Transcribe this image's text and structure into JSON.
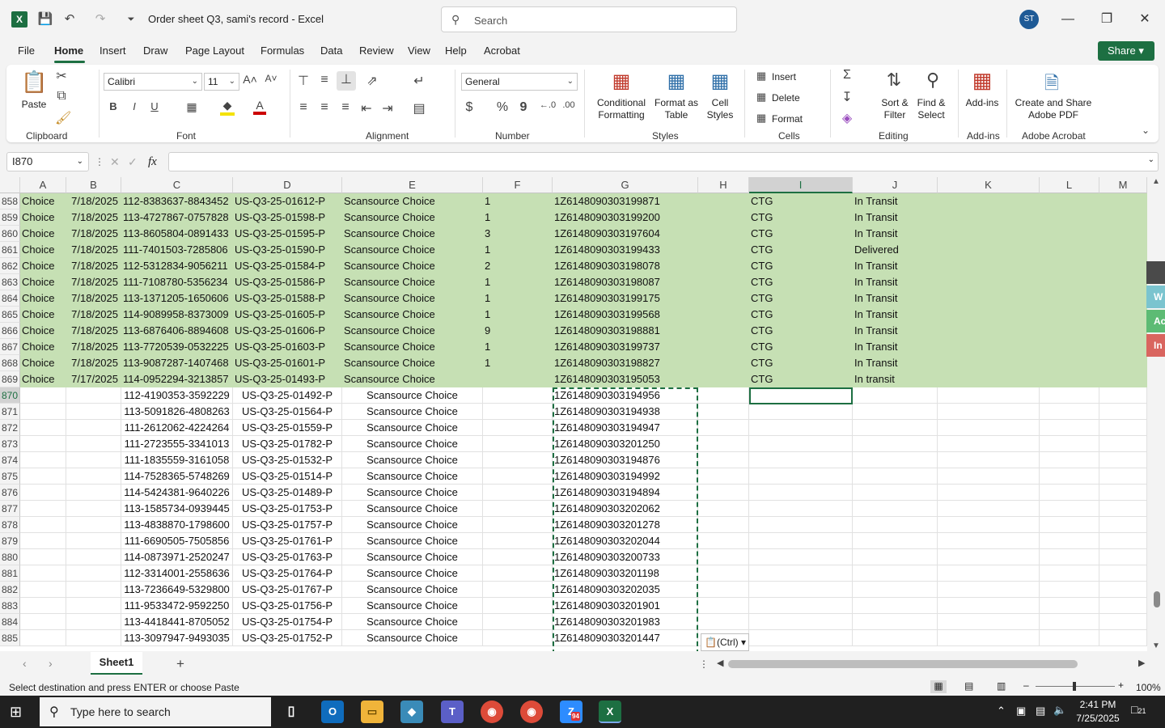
{
  "titlebar": {
    "app_icon": "X",
    "title": "Order sheet Q3, sami's record  -  Excel",
    "search_placeholder": "Search",
    "avatar": "ST"
  },
  "menu": [
    "File",
    "Home",
    "Insert",
    "Draw",
    "Page Layout",
    "Formulas",
    "Data",
    "Review",
    "View",
    "Help",
    "Acrobat"
  ],
  "share_label": "Share",
  "ribbon": {
    "clipboard": {
      "paste": "Paste",
      "label": "Clipboard"
    },
    "font": {
      "name": "Calibri",
      "size": "11",
      "label": "Font"
    },
    "alignment": {
      "label": "Alignment"
    },
    "number": {
      "format": "General",
      "label": "Number",
      "currency": "$",
      "percent": "%",
      "comma": "9"
    },
    "styles": {
      "conditional": "Conditional Formatting",
      "format_table": "Format as Table",
      "cell_styles": "Cell Styles",
      "label": "Styles"
    },
    "cells": {
      "insert": "Insert",
      "delete": "Delete",
      "format": "Format",
      "label": "Cells"
    },
    "editing": {
      "sort": "Sort & Filter",
      "find": "Find & Select",
      "label": "Editing"
    },
    "addins": {
      "addins": "Add-ins",
      "label": "Add-ins"
    },
    "acrobat": {
      "create": "Create and Share Adobe PDF",
      "label": "Adobe Acrobat"
    }
  },
  "formula_bar": {
    "name_box": "I870",
    "fx": "fx",
    "formula": ""
  },
  "columns": [
    "A",
    "B",
    "C",
    "D",
    "E",
    "F",
    "G",
    "H",
    "I",
    "J",
    "K",
    "L",
    "M"
  ],
  "rows": [
    {
      "n": "858",
      "a": "Choice",
      "b": "7/18/2025",
      "c": "112-8383637-8843452",
      "d": "US-Q3-25-01612-P",
      "e": "Scansource Choice",
      "f": "1",
      "g": "1Z6148090303199871",
      "i": "CTG",
      "j": "In Transit"
    },
    {
      "n": "859",
      "a": "Choice",
      "b": "7/18/2025",
      "c": "113-4727867-0757828",
      "d": "US-Q3-25-01598-P",
      "e": "Scansource Choice",
      "f": "1",
      "g": "1Z6148090303199200",
      "i": "CTG",
      "j": "In Transit"
    },
    {
      "n": "860",
      "a": "Choice",
      "b": "7/18/2025",
      "c": "113-8605804-0891433",
      "d": "US-Q3-25-01595-P",
      "e": "Scansource Choice",
      "f": "3",
      "g": "1Z6148090303197604",
      "i": "CTG",
      "j": "In Transit"
    },
    {
      "n": "861",
      "a": "Choice",
      "b": "7/18/2025",
      "c": "111-7401503-7285806",
      "d": "US-Q3-25-01590-P",
      "e": "Scansource Choice",
      "f": "1",
      "g": "1Z6148090303199433",
      "i": "CTG",
      "j": "Delivered"
    },
    {
      "n": "862",
      "a": "Choice",
      "b": "7/18/2025",
      "c": "112-5312834-9056211",
      "d": "US-Q3-25-01584-P",
      "e": "Scansource Choice",
      "f": "2",
      "g": "1Z6148090303198078",
      "i": "CTG",
      "j": "In Transit"
    },
    {
      "n": "863",
      "a": "Choice",
      "b": "7/18/2025",
      "c": "111-7108780-5356234",
      "d": "US-Q3-25-01586-P",
      "e": "Scansource Choice",
      "f": "1",
      "g": "1Z6148090303198087",
      "i": "CTG",
      "j": "In Transit"
    },
    {
      "n": "864",
      "a": "Choice",
      "b": "7/18/2025",
      "c": "113-1371205-1650606",
      "d": "US-Q3-25-01588-P",
      "e": "Scansource Choice",
      "f": "1",
      "g": "1Z6148090303199175",
      "i": "CTG",
      "j": "In Transit"
    },
    {
      "n": "865",
      "a": "Choice",
      "b": "7/18/2025",
      "c": "114-9089958-8373009",
      "d": "US-Q3-25-01605-P",
      "e": "Scansource Choice",
      "f": "1",
      "g": "1Z6148090303199568",
      "i": "CTG",
      "j": "In Transit"
    },
    {
      "n": "866",
      "a": "Choice",
      "b": "7/18/2025",
      "c": "113-6876406-8894608",
      "d": "US-Q3-25-01606-P",
      "e": "Scansource Choice",
      "f": "9",
      "g": "1Z6148090303198881",
      "i": "CTG",
      "j": "In Transit"
    },
    {
      "n": "867",
      "a": "Choice",
      "b": "7/18/2025",
      "c": "113-7720539-0532225",
      "d": "US-Q3-25-01603-P",
      "e": "Scansource Choice",
      "f": "1",
      "g": "1Z6148090303199737",
      "i": "CTG",
      "j": "In Transit"
    },
    {
      "n": "868",
      "a": "Choice",
      "b": "7/18/2025",
      "c": "113-9087287-1407468",
      "d": "US-Q3-25-01601-P",
      "e": "Scansource Choice",
      "f": "1",
      "g": "1Z6148090303198827",
      "i": "CTG",
      "j": "In Transit"
    },
    {
      "n": "869",
      "a": "Choice",
      "b": "7/17/2025",
      "c": "114-0952294-3213857",
      "d": "US-Q3-25-01493-P",
      "e": "Scansource Choice",
      "f": "",
      "g": "1Z6148090303195053",
      "i": "CTG",
      "j": "In transit"
    },
    {
      "n": "870",
      "c": "112-4190353-3592229",
      "d": "US-Q3-25-01492-P",
      "e": "Scansource Choice",
      "g": "1Z6148090303194956"
    },
    {
      "n": "871",
      "c": "113-5091826-4808263",
      "d": "US-Q3-25-01564-P",
      "e": "Scansource Choice",
      "g": "1Z6148090303194938"
    },
    {
      "n": "872",
      "c": "111-2612062-4224264",
      "d": "US-Q3-25-01559-P",
      "e": "Scansource Choice",
      "g": "1Z6148090303194947"
    },
    {
      "n": "873",
      "c": "111-2723555-3341013",
      "d": "US-Q3-25-01782-P",
      "e": "Scansource Choice",
      "g": "1Z6148090303201250"
    },
    {
      "n": "874",
      "c": "111-1835559-3161058",
      "d": "US-Q3-25-01532-P",
      "e": "Scansource Choice",
      "g": "1Z6148090303194876"
    },
    {
      "n": "875",
      "c": "114-7528365-5748269",
      "d": "US-Q3-25-01514-P",
      "e": "Scansource Choice",
      "g": "1Z6148090303194992"
    },
    {
      "n": "876",
      "c": "114-5424381-9640226",
      "d": "US-Q3-25-01489-P",
      "e": "Scansource Choice",
      "g": "1Z6148090303194894"
    },
    {
      "n": "877",
      "c": "113-1585734-0939445",
      "d": "US-Q3-25-01753-P",
      "e": "Scansource Choice",
      "g": "1Z6148090303202062"
    },
    {
      "n": "878",
      "c": "113-4838870-1798600",
      "d": "US-Q3-25-01757-P",
      "e": "Scansource Choice",
      "g": "1Z6148090303201278"
    },
    {
      "n": "879",
      "c": "111-6690505-7505856",
      "d": "US-Q3-25-01761-P",
      "e": "Scansource Choice",
      "g": "1Z6148090303202044"
    },
    {
      "n": "880",
      "c": "114-0873971-2520247",
      "d": "US-Q3-25-01763-P",
      "e": "Scansource Choice",
      "g": "1Z6148090303200733"
    },
    {
      "n": "881",
      "c": "112-3314001-2558636",
      "d": "US-Q3-25-01764-P",
      "e": "Scansource Choice",
      "g": "1Z6148090303201198"
    },
    {
      "n": "882",
      "c": "113-7236649-5329800",
      "d": "US-Q3-25-01767-P",
      "e": "Scansource Choice",
      "g": "1Z6148090303202035"
    },
    {
      "n": "883",
      "c": "111-9533472-9592250",
      "d": "US-Q3-25-01756-P",
      "e": "Scansource Choice",
      "g": "1Z6148090303201901"
    },
    {
      "n": "884",
      "c": "113-4418441-8705052",
      "d": "US-Q3-25-01754-P",
      "e": "Scansource Choice",
      "g": "1Z6148090303201983"
    },
    {
      "n": "885",
      "c": "113-3097947-9493035",
      "d": "US-Q3-25-01752-P",
      "e": "Scansource Choice",
      "g": "1Z6148090303201447"
    }
  ],
  "paste_options": "(Ctrl)",
  "side_flags": [
    "W",
    "Ac",
    "In"
  ],
  "sheet_tab": "Sheet1",
  "status": {
    "message": "Select destination and press ENTER or choose Paste",
    "zoom": "100%"
  },
  "taskbar": {
    "search_placeholder": "Type here to search",
    "time": "2:41 PM",
    "date": "7/25/2025",
    "notif": "21",
    "zoom_badge": "94"
  },
  "colors": {
    "excel_green": "#1d6f42",
    "row_fill": "#c6e0b4"
  }
}
